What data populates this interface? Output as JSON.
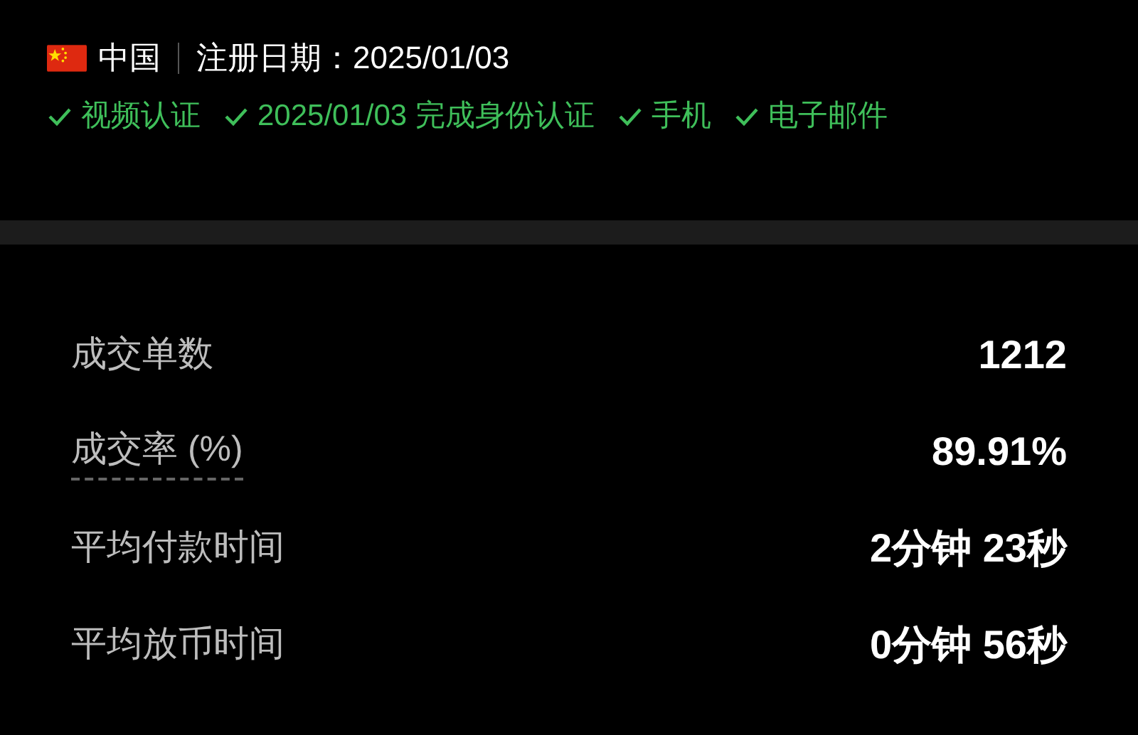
{
  "profile": {
    "country": "中国",
    "registered": "注册日期：2025/01/03"
  },
  "verifications": [
    {
      "label": "视频认证"
    },
    {
      "label": "2025/01/03 完成身份认证"
    },
    {
      "label": "手机"
    },
    {
      "label": "电子邮件"
    }
  ],
  "stats": [
    {
      "label": "成交单数",
      "value": "1212",
      "hint": false
    },
    {
      "label": "成交率 (%)",
      "value": "89.91%",
      "hint": true
    },
    {
      "label": "平均付款时间",
      "value": "2分钟 23秒",
      "hint": false
    },
    {
      "label": "平均放币时间",
      "value": "0分钟 56秒",
      "hint": false
    }
  ]
}
